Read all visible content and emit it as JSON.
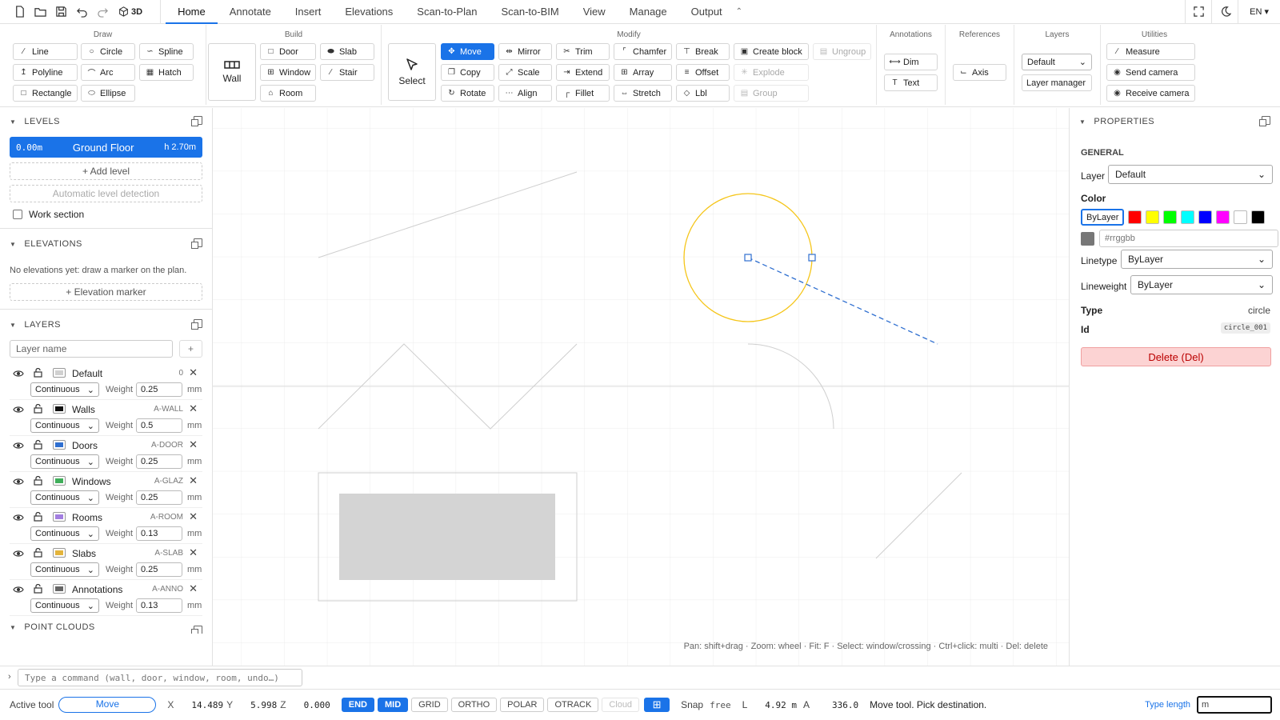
{
  "topbar": {
    "btn_3d": "3D",
    "tabs": [
      "Home",
      "Annotate",
      "Insert",
      "Elevations",
      "Scan-to-Plan",
      "Scan-to-BIM",
      "View",
      "Manage",
      "Output"
    ],
    "lang": "EN"
  },
  "ribbon": {
    "draw": {
      "title": "Draw",
      "line": "Line",
      "circle": "Circle",
      "spline": "Spline",
      "polyline": "Polyline",
      "arc": "Arc",
      "hatch": "Hatch",
      "rectangle": "Rectangle",
      "ellipse": "Ellipse"
    },
    "build": {
      "title": "Build",
      "wall": "Wall",
      "door": "Door",
      "slab": "Slab",
      "window": "Window",
      "stair": "Stair",
      "room": "Room"
    },
    "modify": {
      "title": "Modify",
      "select": "Select",
      "move": "Move",
      "mirror": "Mirror",
      "trim": "Trim",
      "chamfer": "Chamfer",
      "break": "Break",
      "create_block": "Create block",
      "ungroup": "Ungroup",
      "copy": "Copy",
      "scale": "Scale",
      "extend": "Extend",
      "array": "Array",
      "offset": "Offset",
      "explode": "Explode",
      "rotate": "Rotate",
      "align": "Align",
      "fillet": "Fillet",
      "stretch": "Stretch",
      "lbl": "Lbl",
      "group": "Group"
    },
    "annotations": {
      "title": "Annotations",
      "dim": "Dim",
      "text": "Text"
    },
    "references": {
      "title": "References",
      "axis": "Axis"
    },
    "layers": {
      "title": "Layers",
      "current": "Default",
      "manager": "Layer manager"
    },
    "utilities": {
      "title": "Utilities",
      "measure": "Measure",
      "send_camera": "Send camera",
      "receive_camera": "Receive camera"
    }
  },
  "left": {
    "levels_title": "LEVELS",
    "level": {
      "elevation": "0.00m",
      "name": "Ground Floor",
      "height": "h 2.70m"
    },
    "add_level": "+ Add level",
    "auto_detect": "Automatic level detection",
    "work_section": "Work section",
    "elevations_title": "ELEVATIONS",
    "elevations_note": "No elevations yet: draw a marker on the plan.",
    "elevation_marker": "+ Elevation marker",
    "layers_title": "LAYERS",
    "layer_name_placeholder": "Layer name",
    "layer_add": "+",
    "weight_label": "Weight",
    "mm": "mm",
    "layers": [
      {
        "name": "Default",
        "code": "0",
        "linetype": "Continuous",
        "weight": "0.25",
        "color": "#d0d0d0"
      },
      {
        "name": "Walls",
        "code": "A-WALL",
        "linetype": "Continuous",
        "weight": "0.5",
        "color": "#111111"
      },
      {
        "name": "Doors",
        "code": "A-DOOR",
        "linetype": "Continuous",
        "weight": "0.25",
        "color": "#2f6fd0"
      },
      {
        "name": "Windows",
        "code": "A-GLAZ",
        "linetype": "Continuous",
        "weight": "0.25",
        "color": "#3fae5a"
      },
      {
        "name": "Rooms",
        "code": "A-ROOM",
        "linetype": "Continuous",
        "weight": "0.13",
        "color": "#a27ee0"
      },
      {
        "name": "Slabs",
        "code": "A-SLAB",
        "linetype": "Continuous",
        "weight": "0.25",
        "color": "#e3b43c"
      },
      {
        "name": "Annotations",
        "code": "A-ANNO",
        "linetype": "Continuous",
        "weight": "0.13",
        "color": "#666666"
      }
    ],
    "point_clouds_title": "POINT CLOUDS"
  },
  "canvas": {
    "hint": "Pan: shift+drag · Zoom: wheel · Fit: F · Select: window/crossing · Ctrl+click: multi · Del: delete"
  },
  "properties": {
    "title": "PROPERTIES",
    "general": "GENERAL",
    "layer_label": "Layer",
    "layer_value": "Default",
    "color_label": "Color",
    "bylayer": "ByLayer",
    "swatches": [
      "#ff0000",
      "#ffff00",
      "#00ff00",
      "#00ffff",
      "#0000ff",
      "#ff00ff",
      "#ffffff",
      "#000000"
    ],
    "hex_placeholder": "#rrggbb",
    "linetype_label": "Linetype",
    "linetype_value": "ByLayer",
    "lineweight_label": "Lineweight",
    "lineweight_value": "ByLayer",
    "type_label": "Type",
    "type_value": "circle",
    "id_label": "Id",
    "id_value": "circle_001",
    "delete": "Delete (Del)"
  },
  "command": {
    "placeholder": "Type a command (wall, door, window, room, undo…)"
  },
  "status": {
    "active_tool_label": "Active tool",
    "active_tool": "Move",
    "x_label": "X",
    "x": "14.489",
    "y_label": "Y",
    "y": "5.998",
    "z_label": "Z",
    "z": "0.000",
    "toggles": [
      {
        "label": "END",
        "on": true
      },
      {
        "label": "MID",
        "on": true
      },
      {
        "label": "GRID",
        "on": false
      },
      {
        "label": "ORTHO",
        "on": false
      },
      {
        "label": "POLAR",
        "on": false
      },
      {
        "label": "OTRACK",
        "on": false
      },
      {
        "label": "Cloud",
        "on": false,
        "disabled": true
      }
    ],
    "snap_label": "Snap",
    "snap_value": "free",
    "l_label": "L",
    "l_value": "4.92 m",
    "a_label": "A",
    "a_value": "336.0",
    "message": "Move tool. Pick destination.",
    "type_length_label": "Type length",
    "type_length_value": "m"
  },
  "colors": {
    "accent": "#1a73e8",
    "selection": "#f5c518",
    "danger": "#fcd3d3"
  }
}
